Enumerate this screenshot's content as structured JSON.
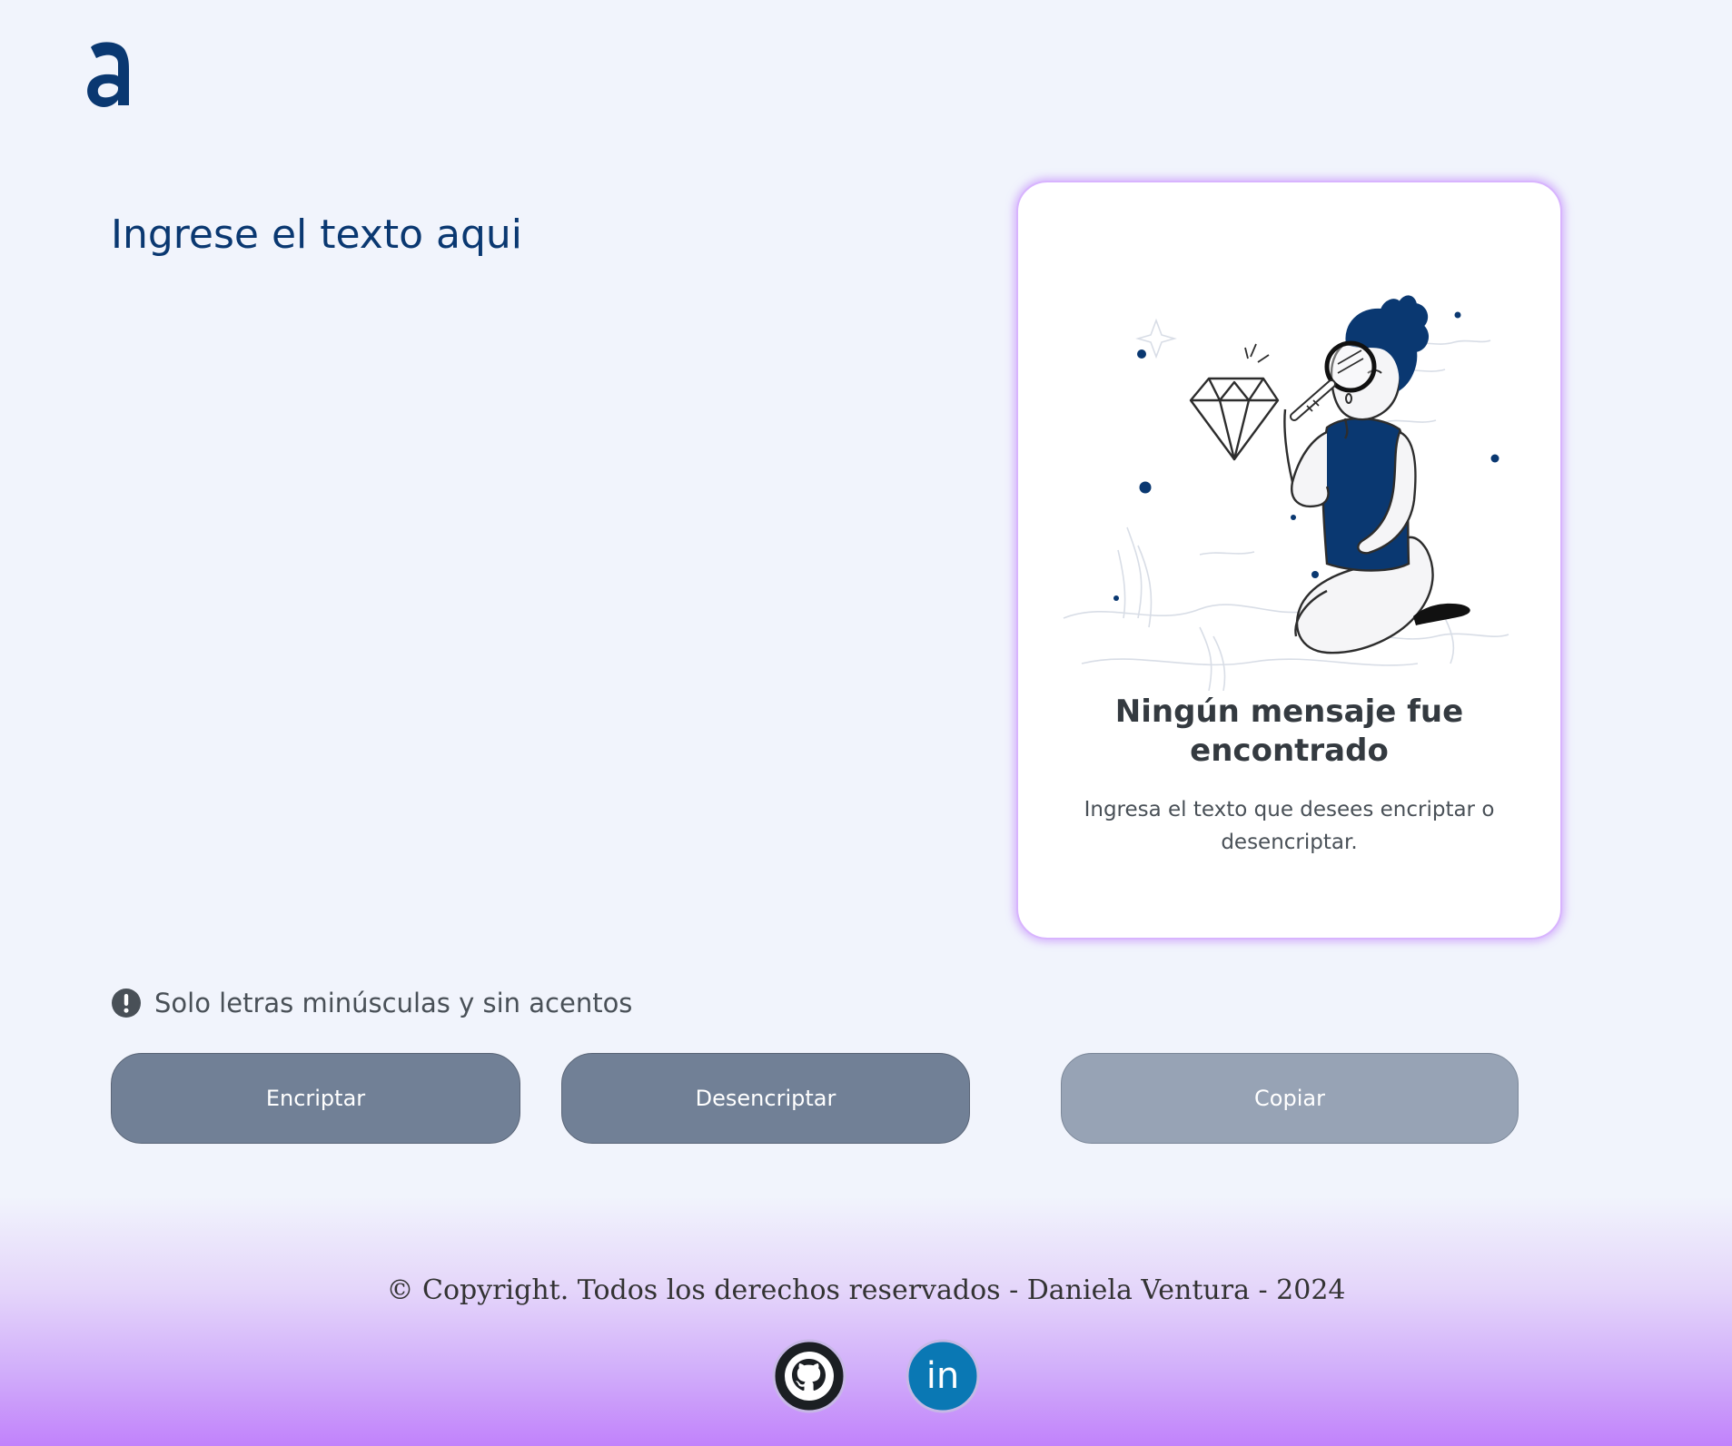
{
  "header": {
    "logo_icon": "alura-a-logo"
  },
  "input": {
    "placeholder": "Ingrese el texto aqui",
    "value": ""
  },
  "output": {
    "illustration_icon": "person-with-magnifier-illustration",
    "title": "Ningún mensaje fue encontrado",
    "description": "Ingresa el texto que desees encriptar o desencriptar."
  },
  "hint": {
    "icon": "exclamation-circle-icon",
    "text": "Solo letras minúsculas y sin acentos"
  },
  "buttons": {
    "encrypt": "Encriptar",
    "decrypt": "Desencriptar",
    "copy": "Copiar"
  },
  "footer": {
    "copyright": "© Copyright. Todos los derechos reservados - Daniela Ventura - 2024",
    "social": [
      {
        "icon": "github-icon"
      },
      {
        "icon": "linkedin-icon",
        "text": "in"
      }
    ]
  },
  "colors": {
    "brand": "#0a3871",
    "background": "#f1f4fc",
    "button": "#718096",
    "button_disabled": "#97a3b5",
    "accent": "#c084fc"
  }
}
